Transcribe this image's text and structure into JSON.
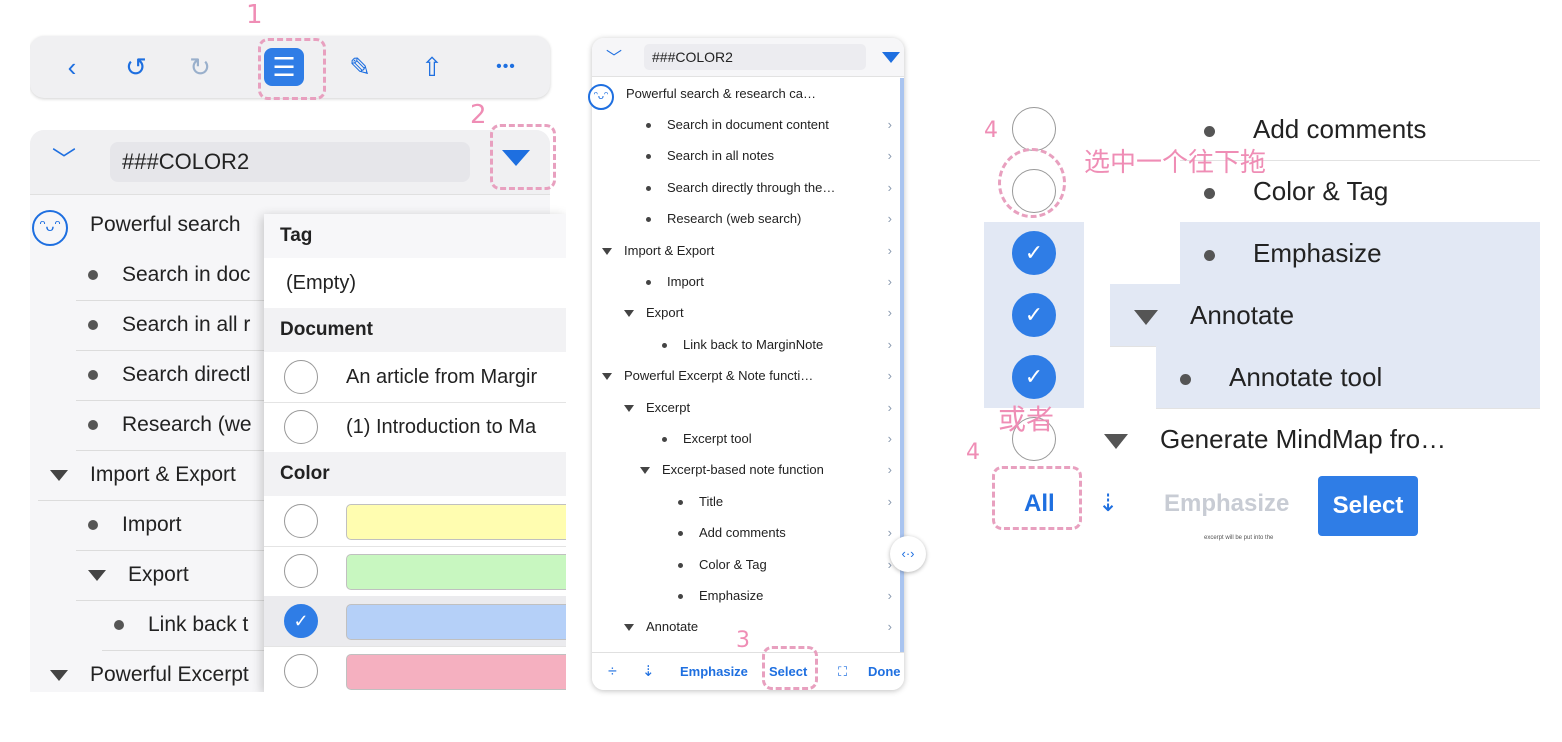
{
  "annotations": {
    "step1": "1",
    "step2": "2",
    "step3": "3",
    "step4a": "4",
    "step4b": "4",
    "drag_note": "选中一个往下拖",
    "or_note": "或者"
  },
  "panel1": {
    "toolbar": {
      "back": "‹",
      "undo": "↺",
      "redo": "↻",
      "outline": "☰",
      "edit": "✎",
      "share": "⇧",
      "more": "•••"
    },
    "search_value": "###COLOR2",
    "root_label": "Powerful search",
    "rows": [
      {
        "label": "Search in doc",
        "kind": "bullet"
      },
      {
        "label": "Search in all r",
        "kind": "bullet"
      },
      {
        "label": "Search directl",
        "kind": "bullet"
      },
      {
        "label": "Research (we",
        "kind": "bullet"
      },
      {
        "label": "Import & Export",
        "kind": "triangle"
      },
      {
        "label": "Import",
        "kind": "bullet"
      },
      {
        "label": "Export",
        "kind": "triangle"
      },
      {
        "label": "Link back t",
        "kind": "bullet"
      },
      {
        "label": "Powerful Excerpt",
        "kind": "triangle"
      }
    ],
    "filter": {
      "tag_header": "Tag",
      "tag_empty": "(Empty)",
      "document_header": "Document",
      "documents": [
        "An article from Margir",
        "(1) Introduction to Ma"
      ],
      "color_header": "Color",
      "colors": [
        {
          "hex": "#fffdb0",
          "checked": false
        },
        {
          "hex": "#c8f7c0",
          "checked": false
        },
        {
          "hex": "#b5d0f8",
          "checked": true
        },
        {
          "hex": "#f5b0c0",
          "checked": false
        }
      ]
    }
  },
  "panel2": {
    "search_value": "###COLOR2",
    "root_label": "Powerful search & research ca…",
    "rows": [
      {
        "label": "Search in document content",
        "kind": "bullet",
        "level": 1
      },
      {
        "label": "Search in all notes",
        "kind": "bullet",
        "level": 1
      },
      {
        "label": "Search directly through the…",
        "kind": "bullet",
        "level": 1
      },
      {
        "label": "Research (web search)",
        "kind": "bullet",
        "level": 1
      },
      {
        "label": "Import & Export",
        "kind": "triangle",
        "level": 0
      },
      {
        "label": "Import",
        "kind": "bullet",
        "level": 1
      },
      {
        "label": "Export",
        "kind": "triangle",
        "level": 1
      },
      {
        "label": "Link back to MarginNote",
        "kind": "bullet",
        "level": 2
      },
      {
        "label": "Powerful Excerpt & Note functi…",
        "kind": "triangle",
        "level": 0
      },
      {
        "label": "Excerpt",
        "kind": "triangle",
        "level": 1
      },
      {
        "label": "Excerpt tool",
        "kind": "bullet",
        "level": 2
      },
      {
        "label": "Excerpt-based note function",
        "kind": "triangle",
        "level": 2
      },
      {
        "label": "Title",
        "kind": "bullet",
        "level": 3
      },
      {
        "label": "Add comments",
        "kind": "bullet",
        "level": 3
      },
      {
        "label": "Color & Tag",
        "kind": "bullet",
        "level": 3
      },
      {
        "label": "Emphasize",
        "kind": "bullet",
        "level": 3
      },
      {
        "label": "Annotate",
        "kind": "triangle",
        "level": 1
      }
    ],
    "bottom": {
      "emphasize": "Emphasize",
      "select": "Select",
      "done": "Done"
    },
    "splitter": "‹·›"
  },
  "panel3": {
    "rows": [
      {
        "label": "Add comments",
        "kind": "bullet",
        "checked": false
      },
      {
        "label": "Color & Tag",
        "kind": "bullet",
        "checked": false
      },
      {
        "label": "Emphasize",
        "kind": "bullet",
        "checked": true
      },
      {
        "label": "Annotate",
        "kind": "triangle",
        "checked": true
      },
      {
        "label": "Annotate tool",
        "kind": "bullet",
        "checked": true
      },
      {
        "label": "Generate MindMap fro…",
        "kind": "triangle",
        "checked": false
      }
    ],
    "bottom": {
      "all": "All",
      "emphasize": "Emphasize",
      "select": "Select"
    },
    "footer_text": "excerpt will be put into the"
  },
  "colors": {
    "accent": "#2f7de6",
    "annotation": "#ef8db5",
    "selected_row": "#e2e8f4"
  }
}
